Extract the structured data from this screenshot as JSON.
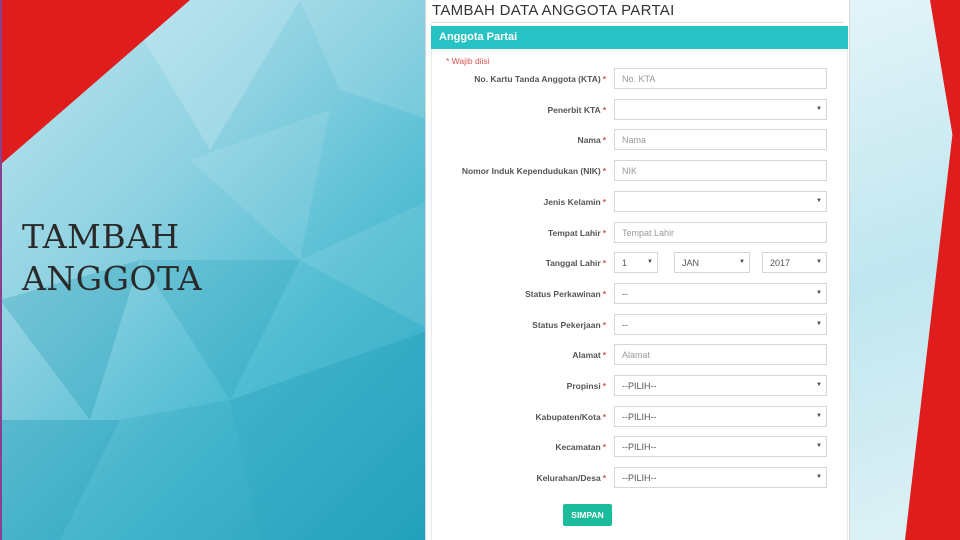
{
  "slide": {
    "title_line1": "TAMBAH",
    "title_line2": "ANGGOTA",
    "colors": {
      "red": "#e01d1d",
      "teal": "#2aa6c0",
      "accent_purple": "#8a3f8f"
    }
  },
  "form_page": {
    "heading": "TAMBAH DATA ANGGOTA PARTAI",
    "card_title": "Anggota Partai",
    "required_note": "* Wajib diisi",
    "required_marker": "*",
    "colors": {
      "card_header": "#26c2c4",
      "submit_button": "#1bbc9b",
      "required": "#d9534f"
    },
    "fields": [
      {
        "label": "No. Kartu Tanda Anggota (KTA)",
        "type": "text",
        "placeholder": "No. KTA"
      },
      {
        "label": "Penerbit KTA",
        "type": "select",
        "value": ""
      },
      {
        "label": "Nama",
        "type": "text",
        "placeholder": "Nama"
      },
      {
        "label": "Nomor Induk Kependudukan (NIK)",
        "type": "text",
        "placeholder": "NIK"
      },
      {
        "label": "Jenis Kelamin",
        "type": "select",
        "value": ""
      },
      {
        "label": "Tempat Lahir",
        "type": "text",
        "placeholder": "Tempat Lahir"
      },
      {
        "label": "Tanggal Lahir",
        "type": "date",
        "day": "1",
        "month": "JAN",
        "year": "2017"
      },
      {
        "label": "Status Perkawinan",
        "type": "select",
        "value": "--"
      },
      {
        "label": "Status Pekerjaan",
        "type": "select",
        "value": "--"
      },
      {
        "label": "Alamat",
        "type": "text",
        "placeholder": "Alamat"
      },
      {
        "label": "Propinsi",
        "type": "select",
        "value": "--PILIH--"
      },
      {
        "label": "Kabupaten/Kota",
        "type": "select",
        "value": "--PILIH--"
      },
      {
        "label": "Kecamatan",
        "type": "select",
        "value": "--PILIH--"
      },
      {
        "label": "Kelurahan/Desa",
        "type": "select",
        "value": "--PILIH--"
      }
    ],
    "submit_label": "SIMPAN",
    "caret_icon": "chevron-down-icon"
  }
}
